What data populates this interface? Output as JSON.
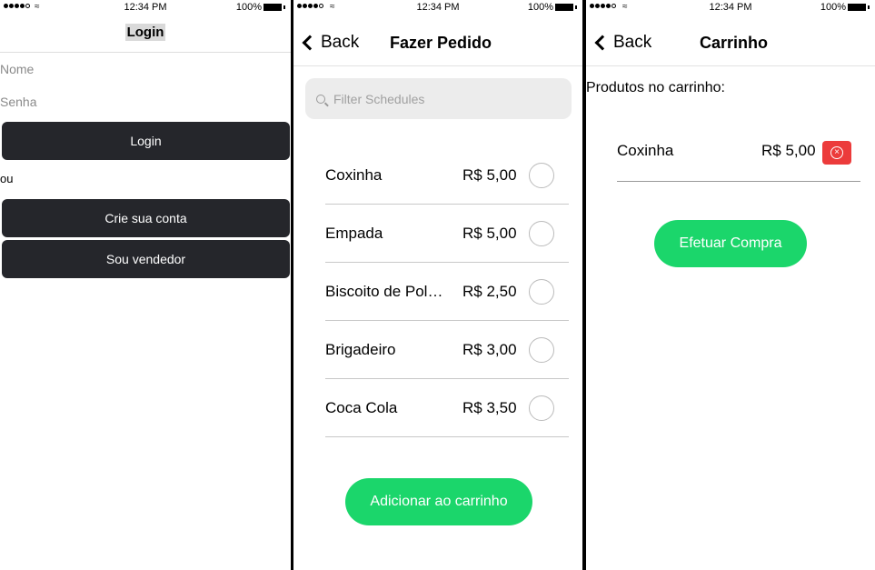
{
  "status": {
    "time": "12:34 PM",
    "battery": "100%",
    "signal_icon": "signal-dots-icon",
    "wifi_icon": "wifi-icon",
    "battery_icon": "battery-icon"
  },
  "login": {
    "title": "Login",
    "name_placeholder": "Nome",
    "password_placeholder": "Senha",
    "login_button": "Login",
    "or_text": "ou",
    "create_account_button": "Crie sua conta",
    "seller_button": "Sou vendedor"
  },
  "order": {
    "back_label": "Back",
    "title": "Fazer Pedido",
    "search_placeholder": "Filter Schedules",
    "items": [
      {
        "name": "Coxinha",
        "price": "R$ 5,00"
      },
      {
        "name": "Empada",
        "price": "R$ 5,00"
      },
      {
        "name": "Biscoito de Pol…",
        "price": "R$ 2,50"
      },
      {
        "name": "Brigadeiro",
        "price": "R$ 3,00"
      },
      {
        "name": "Coca Cola",
        "price": "R$ 3,50"
      }
    ],
    "add_button": "Adicionar ao carrinho"
  },
  "cart": {
    "back_label": "Back",
    "title": "Carrinho",
    "label": "Produtos no carrinho:",
    "items": [
      {
        "name": "Coxinha",
        "price": "R$ 5,00"
      }
    ],
    "purchase_button": "Efetuar Compra"
  },
  "colors": {
    "accent_green": "#1bd66b",
    "dark_button": "#25262b",
    "delete_red": "#ec3b3b"
  }
}
